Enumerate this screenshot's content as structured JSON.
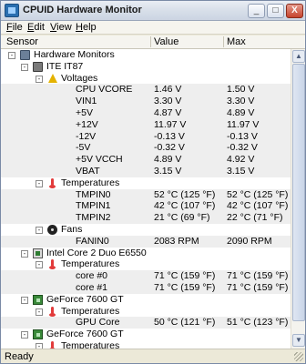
{
  "window": {
    "title": "CPUID Hardware Monitor",
    "buttons": {
      "minimize": "_",
      "maximize": "□",
      "close": "X"
    }
  },
  "menu": [
    {
      "label": "File",
      "underline": "F",
      "rest": "ile"
    },
    {
      "label": "Edit",
      "underline": "E",
      "rest": "dit"
    },
    {
      "label": "View",
      "underline": "V",
      "rest": "iew"
    },
    {
      "label": "Help",
      "underline": "H",
      "rest": "elp"
    }
  ],
  "columns": {
    "sensor": "Sensor",
    "value": "Value",
    "max": "Max"
  },
  "tree": [
    {
      "level": 0,
      "expander": "-",
      "icon": "computer-icon",
      "label": "Hardware Monitors",
      "value": "",
      "max": ""
    },
    {
      "level": 1,
      "expander": "-",
      "icon": "chip-icon",
      "label": "ITE IT87",
      "value": "",
      "max": ""
    },
    {
      "level": 2,
      "expander": "-",
      "icon": "voltage-icon",
      "label": "Voltages",
      "value": "",
      "max": ""
    },
    {
      "level": 3,
      "label": "CPU VCORE",
      "value": "1.46 V",
      "max": "1.50 V"
    },
    {
      "level": 3,
      "label": "VIN1",
      "value": "3.30 V",
      "max": "3.30 V"
    },
    {
      "level": 3,
      "label": "+5V",
      "value": "4.87 V",
      "max": "4.89 V"
    },
    {
      "level": 3,
      "label": "+12V",
      "value": "11.97 V",
      "max": "11.97 V"
    },
    {
      "level": 3,
      "label": "-12V",
      "value": "-0.13 V",
      "max": "-0.13 V"
    },
    {
      "level": 3,
      "label": "-5V",
      "value": "-0.32 V",
      "max": "-0.32 V"
    },
    {
      "level": 3,
      "label": "+5V VCCH",
      "value": "4.89 V",
      "max": "4.92 V"
    },
    {
      "level": 3,
      "label": "VBAT",
      "value": "3.15 V",
      "max": "3.15 V"
    },
    {
      "level": 2,
      "expander": "-",
      "icon": "thermometer-icon",
      "label": "Temperatures",
      "value": "",
      "max": ""
    },
    {
      "level": 3,
      "label": "TMPIN0",
      "value": "52 °C (125 °F)",
      "max": "52 °C (125 °F)"
    },
    {
      "level": 3,
      "label": "TMPIN1",
      "value": "42 °C (107 °F)",
      "max": "42 °C (107 °F)"
    },
    {
      "level": 3,
      "label": "TMPIN2",
      "value": "21 °C (69 °F)",
      "max": "22 °C (71 °F)"
    },
    {
      "level": 2,
      "expander": "-",
      "icon": "fan-icon",
      "label": "Fans",
      "value": "",
      "max": ""
    },
    {
      "level": 3,
      "label": "FANIN0",
      "value": "2083 RPM",
      "max": "2090 RPM"
    },
    {
      "level": 1,
      "expander": "-",
      "icon": "cpu-icon",
      "label": "Intel Core 2 Duo E6550",
      "value": "",
      "max": ""
    },
    {
      "level": 2,
      "expander": "-",
      "icon": "thermometer-icon",
      "label": "Temperatures",
      "value": "",
      "max": ""
    },
    {
      "level": 3,
      "label": "core #0",
      "value": "71 °C (159 °F)",
      "max": "71 °C (159 °F)"
    },
    {
      "level": 3,
      "label": "core #1",
      "value": "71 °C (159 °F)",
      "max": "71 °C (159 °F)"
    },
    {
      "level": 1,
      "expander": "-",
      "icon": "gpu-icon",
      "label": "GeForce 7600 GT",
      "value": "",
      "max": ""
    },
    {
      "level": 2,
      "expander": "-",
      "icon": "thermometer-icon",
      "label": "Temperatures",
      "value": "",
      "max": ""
    },
    {
      "level": 3,
      "label": "GPU Core",
      "value": "50 °C (121 °F)",
      "max": "51 °C (123 °F)"
    },
    {
      "level": 1,
      "expander": "-",
      "icon": "gpu-icon",
      "label": "GeForce 7600 GT",
      "value": "",
      "max": ""
    },
    {
      "level": 2,
      "expander": "-",
      "icon": "thermometer-icon",
      "label": "Temperatures",
      "value": "",
      "max": ""
    }
  ],
  "status": {
    "text": "Ready"
  }
}
